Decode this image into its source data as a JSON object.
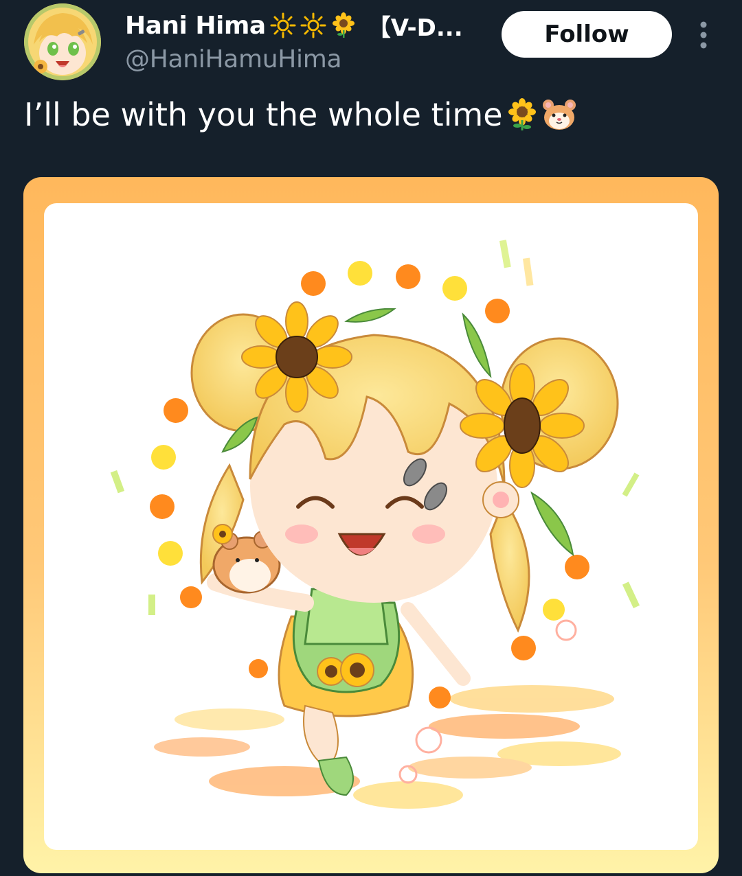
{
  "author": {
    "display_name": "Hani Hima",
    "name_suffix": "【V-D...",
    "handle": "@HaniHamuHima",
    "name_icons": [
      "sun-icon",
      "sun-icon",
      "sunflower-icon"
    ]
  },
  "actions": {
    "follow_label": "Follow",
    "more_icon": "more-vertical-icon"
  },
  "tweet": {
    "text": "I’ll be with you the whole time",
    "emojis": [
      "sunflower-icon",
      "hamster-icon"
    ]
  },
  "media": {
    "kind": "illustration",
    "frame_color": "#ffb85c",
    "frame_color_bottom": "#fff3a8"
  },
  "colors": {
    "background": "#15202b",
    "text_primary": "#ffffff",
    "text_secondary": "#8b98a5",
    "button_bg": "#ffffff",
    "button_text": "#0f1419"
  }
}
